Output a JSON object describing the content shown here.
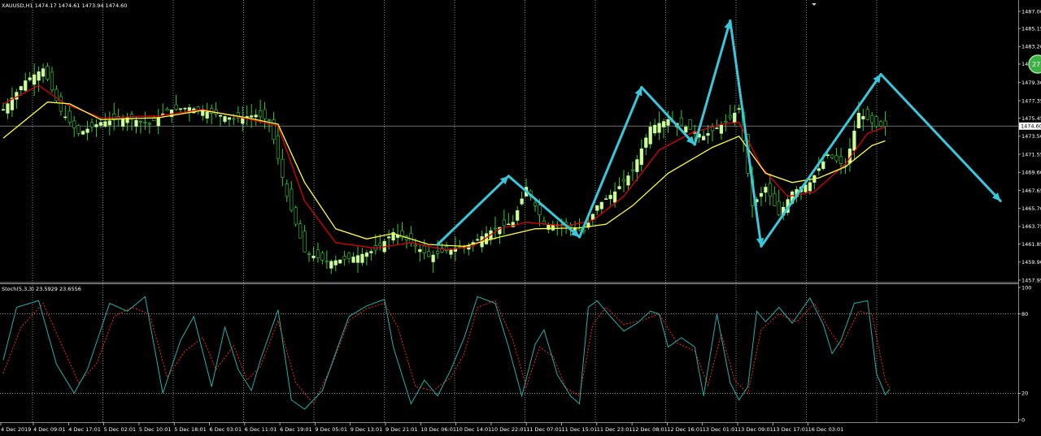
{
  "window": {
    "symbol_info": "XAUUSD,H1  1474.17 1474.61 1473.94 1474.60",
    "indicator_info": "Stoch(5,3,3) 23.5929 23.6556"
  },
  "colors": {
    "background": "#000000",
    "bull_candle": "#ccff99",
    "bear_candle": "#000000",
    "wick": "#33cc33",
    "ma_fast": "#e00000",
    "ma_slow": "#ffff33",
    "arrows": "#38c8dc",
    "stoch_main": "#20b2aa",
    "stoch_signal": "#ff2020",
    "grid": "#c0c0c0"
  },
  "price_axis": {
    "ticks": [
      "1487.00",
      "1485.15",
      "1483.20",
      "1481.30",
      "1479.30",
      "1477.35",
      "1475.45",
      "1473.50",
      "1471.55",
      "1469.60",
      "1467.65",
      "1465.70",
      "1463.75",
      "1461.85",
      "1459.90",
      "1457.95"
    ],
    "current_price": "1474.60",
    "badge": "27"
  },
  "stoch_axis": {
    "ticks": [
      "100",
      "80",
      "20",
      "0"
    ]
  },
  "time_axis": {
    "labels": [
      "4 Dec 2019",
      "4 Dec 09:01",
      "4 Dec 17:01",
      "5 Dec 02:01",
      "5 Dec 10:01",
      "5 Dec 18:01",
      "6 Dec 03:01",
      "6 Dec 11:01",
      "6 Dec 19:01",
      "9 Dec 05:01",
      "9 Dec 13:01",
      "9 Dec 21:01",
      "10 Dec 06:01",
      "10 Dec 14:01",
      "10 Dec 22:01",
      "11 Dec 07:01",
      "11 Dec 15:01",
      "11 Dec 23:01",
      "12 Dec 08:01",
      "12 Dec 16:01",
      "13 Dec 01:01",
      "13 Dec 09:01",
      "13 Dec 17:01",
      "16 Dec 03:01"
    ]
  },
  "chart_data": {
    "type": "candlestick",
    "y_range": [
      1457.95,
      1487.0
    ],
    "close_path": [
      [
        0,
        1476.4
      ],
      [
        5,
        1479.5
      ],
      [
        9,
        1480.8
      ],
      [
        13,
        1476.2
      ],
      [
        17,
        1473.8
      ],
      [
        22,
        1475.0
      ],
      [
        28,
        1475.5
      ],
      [
        33,
        1474.8
      ],
      [
        37,
        1476.3
      ],
      [
        42,
        1476.6
      ],
      [
        47,
        1476.0
      ],
      [
        52,
        1475.4
      ],
      [
        57,
        1475.8
      ],
      [
        60,
        1475.2
      ],
      [
        64,
        1467.0
      ],
      [
        68,
        1461.0
      ],
      [
        73,
        1459.9
      ],
      [
        78,
        1460.3
      ],
      [
        84,
        1461.2
      ],
      [
        88,
        1463.1
      ],
      [
        92,
        1462.0
      ],
      [
        96,
        1460.5
      ],
      [
        101,
        1461.3
      ],
      [
        105,
        1461.7
      ],
      [
        110,
        1463.3
      ],
      [
        115,
        1464.2
      ],
      [
        118,
        1468.0
      ],
      [
        122,
        1464.0
      ],
      [
        127,
        1463.9
      ],
      [
        131,
        1463.2
      ],
      [
        134,
        1466.0
      ],
      [
        138,
        1467.5
      ],
      [
        142,
        1469.8
      ],
      [
        146,
        1474.5
      ],
      [
        150,
        1475.3
      ],
      [
        154,
        1474.5
      ],
      [
        158,
        1473.5
      ],
      [
        163,
        1475.0
      ],
      [
        166,
        1476.5
      ],
      [
        169,
        1466.0
      ],
      [
        172,
        1468.0
      ],
      [
        175,
        1465.0
      ],
      [
        178,
        1467.5
      ],
      [
        182,
        1468.5
      ],
      [
        186,
        1471.5
      ],
      [
        190,
        1470.2
      ],
      [
        193,
        1476.0
      ],
      [
        197,
        1474.6
      ]
    ],
    "ma_fast": [
      [
        0,
        1477.0
      ],
      [
        8,
        1479.0
      ],
      [
        14,
        1477.0
      ],
      [
        22,
        1475.5
      ],
      [
        35,
        1475.7
      ],
      [
        45,
        1476.4
      ],
      [
        55,
        1475.4
      ],
      [
        62,
        1474.6
      ],
      [
        68,
        1466.5
      ],
      [
        75,
        1462.0
      ],
      [
        84,
        1461.4
      ],
      [
        92,
        1462.0
      ],
      [
        100,
        1461.2
      ],
      [
        106,
        1461.6
      ],
      [
        112,
        1463.5
      ],
      [
        118,
        1464.2
      ],
      [
        127,
        1463.8
      ],
      [
        133,
        1464.4
      ],
      [
        140,
        1467.0
      ],
      [
        148,
        1472.0
      ],
      [
        155,
        1473.8
      ],
      [
        162,
        1474.8
      ],
      [
        166,
        1475.0
      ],
      [
        171,
        1470.2
      ],
      [
        177,
        1467.0
      ],
      [
        183,
        1467.5
      ],
      [
        190,
        1470.5
      ],
      [
        195,
        1473.8
      ],
      [
        199,
        1474.5
      ]
    ],
    "ma_slow": [
      [
        0,
        1473.3
      ],
      [
        10,
        1477.2
      ],
      [
        15,
        1477.0
      ],
      [
        22,
        1475.3
      ],
      [
        35,
        1475.5
      ],
      [
        45,
        1476.3
      ],
      [
        55,
        1475.5
      ],
      [
        62,
        1474.8
      ],
      [
        68,
        1468.5
      ],
      [
        75,
        1463.5
      ],
      [
        82,
        1462.4
      ],
      [
        88,
        1463.0
      ],
      [
        96,
        1461.8
      ],
      [
        104,
        1461.6
      ],
      [
        112,
        1462.6
      ],
      [
        120,
        1463.5
      ],
      [
        130,
        1463.6
      ],
      [
        136,
        1464.0
      ],
      [
        142,
        1466.0
      ],
      [
        150,
        1469.5
      ],
      [
        160,
        1472.3
      ],
      [
        166,
        1473.5
      ],
      [
        172,
        1469.5
      ],
      [
        178,
        1468.5
      ],
      [
        184,
        1469.0
      ],
      [
        190,
        1470.2
      ],
      [
        196,
        1472.5
      ],
      [
        199,
        1473.0
      ]
    ],
    "arrows": [
      [
        98,
        1461.8
      ],
      [
        114,
        1469.2
      ],
      [
        130,
        1462.6
      ],
      [
        144,
        1478.8
      ],
      [
        156,
        1472.6
      ],
      [
        164,
        1486.0
      ],
      [
        171,
        1461.6
      ],
      [
        198,
        1480.2
      ],
      [
        225,
        1466.5
      ]
    ],
    "stochastic": {
      "range": [
        0,
        100
      ],
      "levels": [
        20,
        80
      ],
      "main": [
        [
          0,
          45
        ],
        [
          3,
          85
        ],
        [
          8,
          90
        ],
        [
          12,
          42
        ],
        [
          16,
          20
        ],
        [
          19,
          38
        ],
        [
          24,
          88
        ],
        [
          28,
          82
        ],
        [
          32,
          93
        ],
        [
          36,
          20
        ],
        [
          40,
          60
        ],
        [
          43,
          78
        ],
        [
          47,
          25
        ],
        [
          50,
          70
        ],
        [
          53,
          38
        ],
        [
          56,
          22
        ],
        [
          58,
          45
        ],
        [
          62,
          83
        ],
        [
          65,
          15
        ],
        [
          68,
          8
        ],
        [
          72,
          22
        ],
        [
          76,
          60
        ],
        [
          78,
          78
        ],
        [
          82,
          86
        ],
        [
          86,
          91
        ],
        [
          88,
          55
        ],
        [
          92,
          12
        ],
        [
          95,
          30
        ],
        [
          98,
          18
        ],
        [
          101,
          38
        ],
        [
          104,
          62
        ],
        [
          107,
          93
        ],
        [
          111,
          88
        ],
        [
          114,
          55
        ],
        [
          117,
          18
        ],
        [
          120,
          57
        ],
        [
          122,
          68
        ],
        [
          125,
          34
        ],
        [
          128,
          18
        ],
        [
          130,
          12
        ],
        [
          132,
          85
        ],
        [
          134,
          90
        ],
        [
          137,
          78
        ],
        [
          140,
          67
        ],
        [
          143,
          73
        ],
        [
          146,
          82
        ],
        [
          148,
          80
        ],
        [
          150,
          55
        ],
        [
          153,
          62
        ],
        [
          156,
          55
        ],
        [
          158,
          18
        ],
        [
          161,
          80
        ],
        [
          164,
          28
        ],
        [
          166,
          15
        ],
        [
          168,
          25
        ],
        [
          170,
          82
        ],
        [
          172,
          74
        ],
        [
          175,
          85
        ],
        [
          178,
          73
        ],
        [
          182,
          92
        ],
        [
          185,
          72
        ],
        [
          187,
          50
        ],
        [
          189,
          60
        ],
        [
          192,
          88
        ],
        [
          195,
          90
        ],
        [
          197,
          35
        ],
        [
          199,
          19
        ],
        [
          200,
          23
        ]
      ],
      "signal": [
        [
          0,
          35
        ],
        [
          4,
          70
        ],
        [
          9,
          88
        ],
        [
          13,
          58
        ],
        [
          17,
          28
        ],
        [
          21,
          42
        ],
        [
          25,
          78
        ],
        [
          29,
          85
        ],
        [
          33,
          80
        ],
        [
          37,
          32
        ],
        [
          41,
          52
        ],
        [
          45,
          62
        ],
        [
          48,
          38
        ],
        [
          52,
          56
        ],
        [
          55,
          30
        ],
        [
          58,
          40
        ],
        [
          62,
          75
        ],
        [
          66,
          28
        ],
        [
          70,
          12
        ],
        [
          74,
          40
        ],
        [
          78,
          75
        ],
        [
          82,
          84
        ],
        [
          86,
          88
        ],
        [
          89,
          70
        ],
        [
          93,
          25
        ],
        [
          97,
          22
        ],
        [
          101,
          32
        ],
        [
          104,
          50
        ],
        [
          107,
          85
        ],
        [
          111,
          90
        ],
        [
          115,
          60
        ],
        [
          118,
          25
        ],
        [
          121,
          55
        ],
        [
          124,
          48
        ],
        [
          127,
          24
        ],
        [
          130,
          18
        ],
        [
          133,
          72
        ],
        [
          136,
          85
        ],
        [
          140,
          72
        ],
        [
          144,
          75
        ],
        [
          148,
          80
        ],
        [
          152,
          58
        ],
        [
          156,
          52
        ],
        [
          159,
          26
        ],
        [
          162,
          65
        ],
        [
          165,
          30
        ],
        [
          168,
          20
        ],
        [
          171,
          68
        ],
        [
          175,
          80
        ],
        [
          179,
          74
        ],
        [
          183,
          88
        ],
        [
          186,
          70
        ],
        [
          189,
          55
        ],
        [
          193,
          82
        ],
        [
          196,
          80
        ],
        [
          199,
          30
        ],
        [
          200,
          24
        ]
      ]
    }
  }
}
